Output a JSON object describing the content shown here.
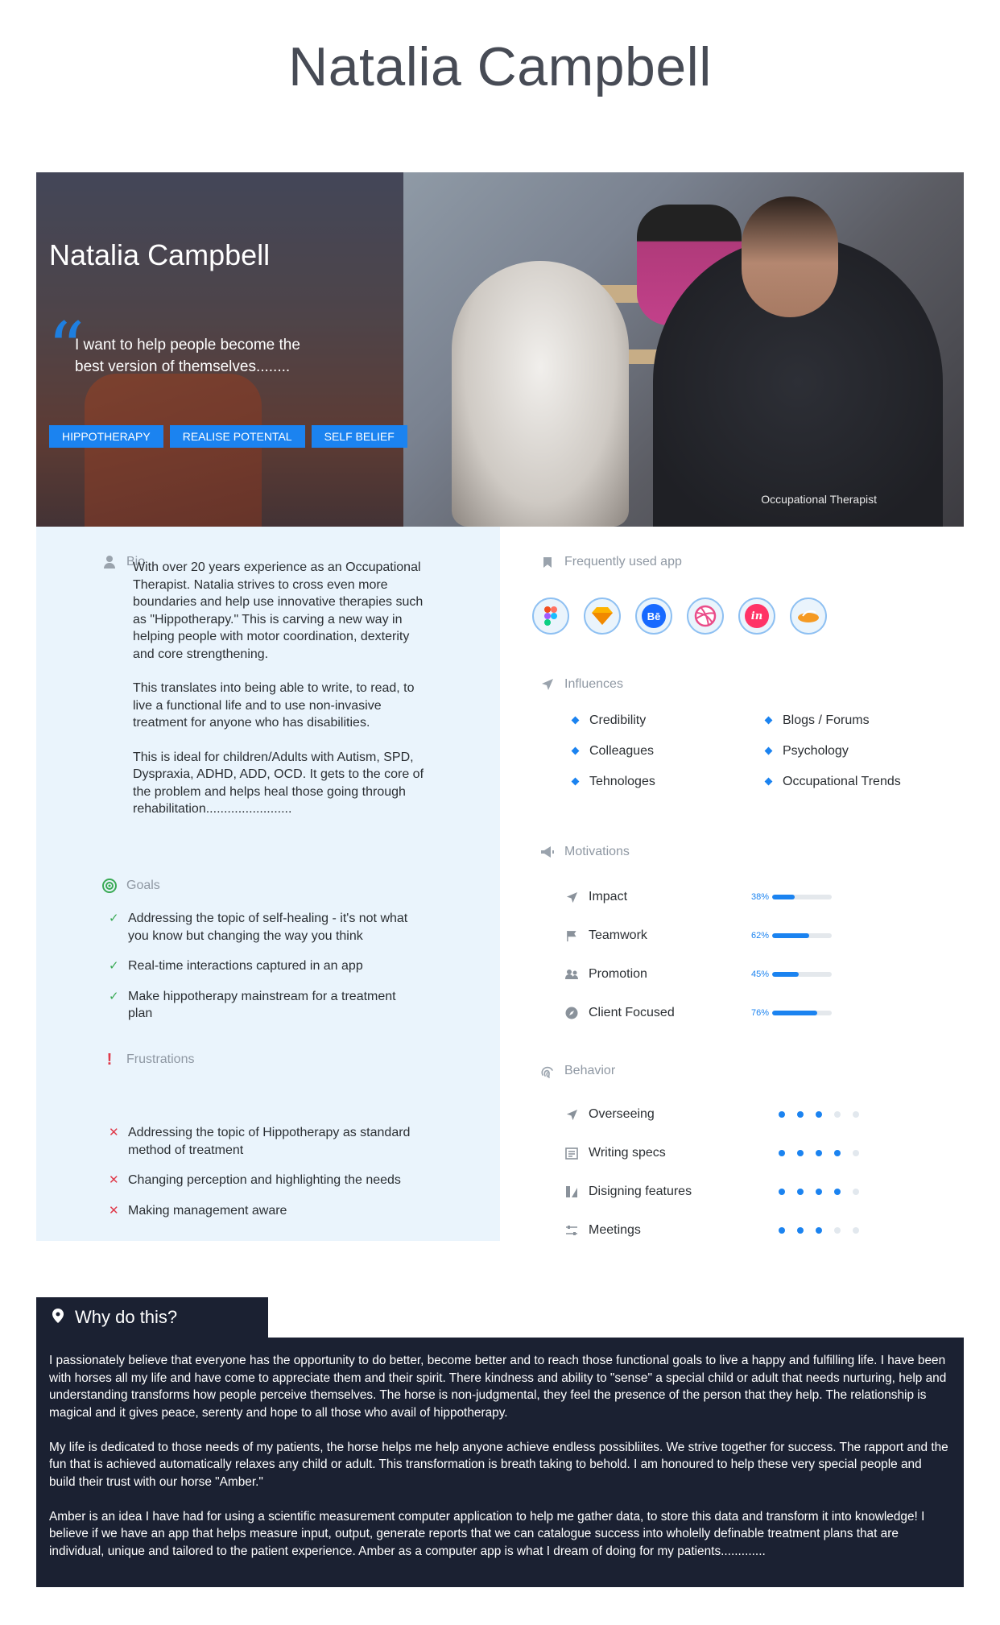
{
  "page": {
    "title": "Natalia Campbell"
  },
  "hero": {
    "name": "Natalia Campbell",
    "quote": "I want to help people become the best version of themselves........",
    "tags": [
      "HIPPOTHERAPY",
      "REALISE POTENTAL",
      "SELF BELIEF"
    ],
    "role": "Occupational Therapist"
  },
  "bio": {
    "heading": "Bio",
    "paragraphs": [
      "With over 20 years experience as an Occupational Therapist. Natalia strives to cross even more boundaries and help use innovative therapies such as \"Hippotherapy.\" This is carving a new way in helping people with motor coordination, dexterity and core strengthening.",
      "This translates into being able to write, to read, to live a functional life and to use non-invasive treatment for anyone who has disabilities.",
      "This is ideal for children/Adults with Autism, SPD, Dyspraxia, ADHD, ADD, OCD. It gets to the core of the problem and helps heal those going through rehabilitation........................"
    ]
  },
  "goals": {
    "heading": "Goals",
    "items": [
      "Addressing the topic of self-healing - it's not what you know but changing the way you think",
      "Real-time interactions captured in an app",
      "Make hippotherapy mainstream for a treatment plan"
    ]
  },
  "frustrations": {
    "heading": "Frustrations",
    "items": [
      "Addressing the topic of Hippotherapy as standard method of treatment",
      "Changing perception and highlighting the needs",
      "Making management aware"
    ]
  },
  "apps": {
    "heading": "Frequently used app",
    "items": [
      {
        "name": "figma-icon",
        "color": "#ffffff"
      },
      {
        "name": "sketch-icon",
        "color": "#f7b500"
      },
      {
        "name": "behance-icon",
        "color": "#1769ff"
      },
      {
        "name": "dribbble-icon",
        "color": "#ea4c89"
      },
      {
        "name": "invision-icon",
        "color": "#ff3366"
      },
      {
        "name": "swift-icon",
        "color": "#f59a23"
      }
    ]
  },
  "influences": {
    "heading": "Influences",
    "items": [
      "Credibility",
      "Blogs / Forums",
      "Colleagues",
      "Psychology",
      "Tehnologes",
      "Occupational Trends"
    ]
  },
  "motivations": {
    "heading": "Motivations",
    "items": [
      {
        "label": "Impact",
        "percent_text": "38%",
        "value": 38
      },
      {
        "label": "Teamwork",
        "percent_text": "62%",
        "value": 62
      },
      {
        "label": "Promotion",
        "percent_text": "45%",
        "value": 45
      },
      {
        "label": "Client Focused",
        "percent_text": "76%",
        "value": 76
      }
    ]
  },
  "behavior": {
    "heading": "Behavior",
    "items": [
      {
        "label": "Overseeing",
        "level": 3,
        "max": 5
      },
      {
        "label": "Writing specs",
        "level": 4,
        "max": 5
      },
      {
        "label": "Disigning features",
        "level": 4,
        "max": 5
      },
      {
        "label": "Meetings",
        "level": 3,
        "max": 5
      }
    ]
  },
  "why": {
    "heading": "Why do this?",
    "paragraphs": [
      "I passionately believe that everyone has the opportunity to do better, become better and to reach those functional goals to live a happy and fulfilling life. I have been with horses all my life and have come to appreciate them and their spirit. There kindness and ability to \"sense\" a special child or adult that needs nurturing, help and understanding transforms how people perceive themselves. The horse is non-judgmental, they feel the presence of the person that they help. The relationship is magical and it gives peace, serenty and hope to all those who avail of hippotherapy.",
      "My life is dedicated to those needs of my patients, the horse helps me help anyone achieve endless possibliites. We strive together for success. The rapport and the fun that is achieved automatically relaxes any child or adult. This transformation is breath taking to behold. I am honoured to help these very special people and build their trust with our horse \"Amber.\"",
      "Amber is an idea I have had for using a scientific measurement computer application to help me gather data, to store this data and transform it into knowledge! I believe if we have an app that helps measure input, output, generate reports that we can catalogue success into wholelly definable treatment plans that are individual, unique and tailored to the patient experience. Amber as a computer app is what I dream of doing for my patients............."
    ]
  }
}
